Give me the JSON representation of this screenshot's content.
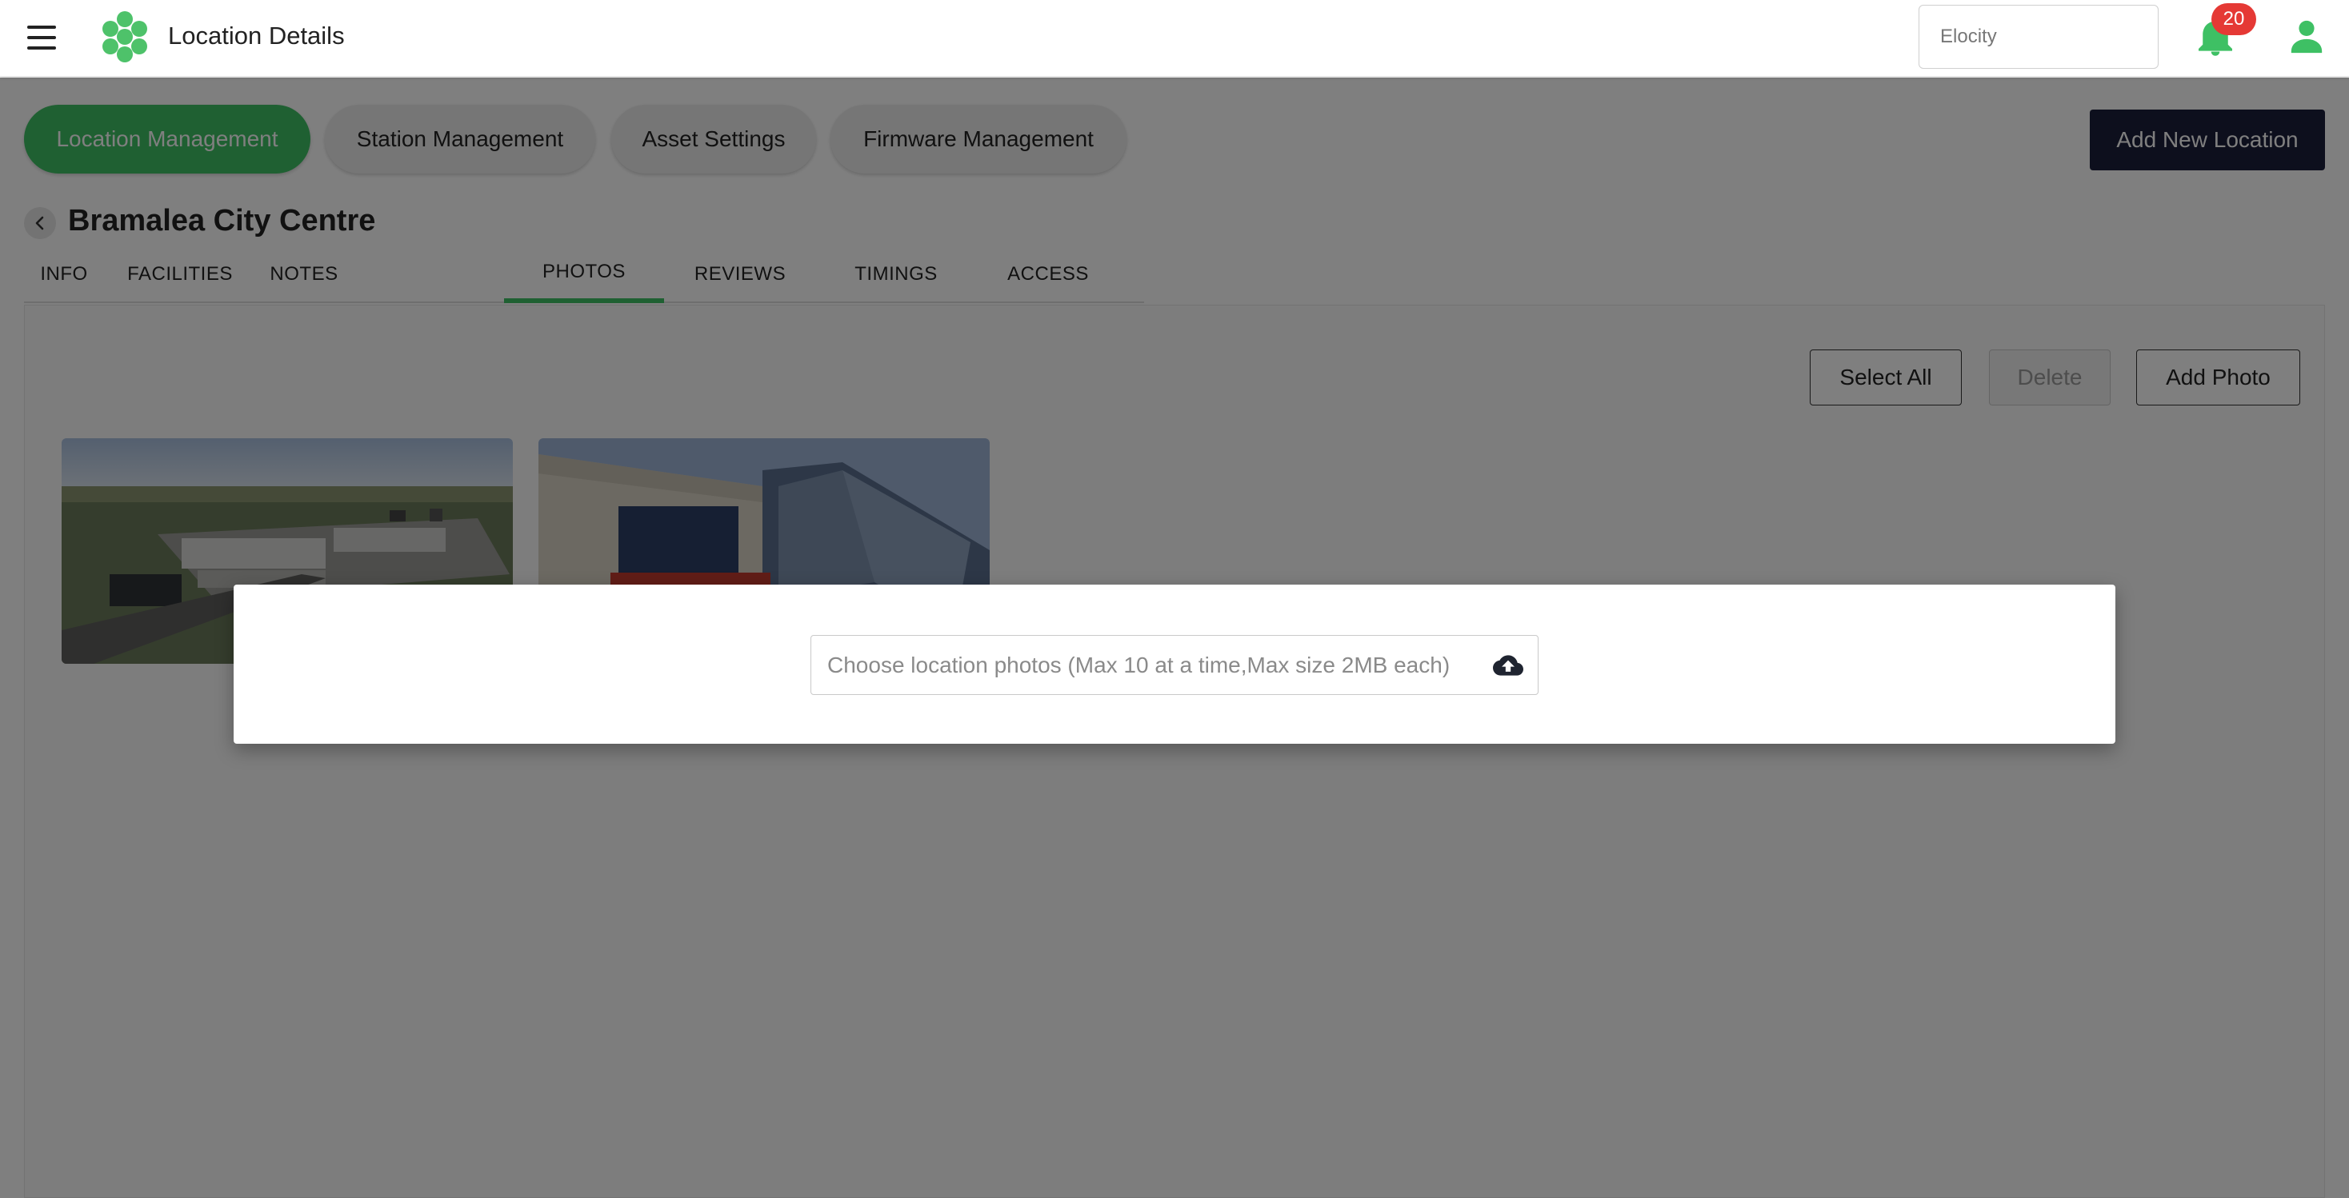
{
  "app": {
    "title": "Location Details",
    "organization_placeholder": "Elocity",
    "notification_count": "20"
  },
  "nav_tabs": [
    {
      "label": "Location Management",
      "active": true
    },
    {
      "label": "Station Management",
      "active": false
    },
    {
      "label": "Asset Settings",
      "active": false
    },
    {
      "label": "Firmware Management",
      "active": false
    }
  ],
  "add_location_label": "Add New Location",
  "location": {
    "name": "Bramalea City Centre"
  },
  "detail_tabs": [
    {
      "label": "INFO",
      "active": false
    },
    {
      "label": "FACILITIES",
      "active": false
    },
    {
      "label": "NOTES",
      "active": false
    },
    {
      "label": "PHOTOS",
      "active": true
    },
    {
      "label": "REVIEWS",
      "active": false
    },
    {
      "label": "TIMINGS",
      "active": false
    },
    {
      "label": "ACCESS",
      "active": false
    }
  ],
  "photo_actions": {
    "select_all": "Select All",
    "delete": "Delete",
    "add_photo": "Add Photo"
  },
  "photos": [
    "aerial-mall-photo",
    "mall-entrance-photo"
  ],
  "dialog": {
    "file_placeholder": "Choose location photos (Max 10 at a time,Max size 2MB each)"
  },
  "colors": {
    "accent": "#3ec064",
    "dark_button": "#1b1e3b",
    "badge": "#e53935"
  },
  "icons": {
    "menu": "hamburger-menu-icon",
    "logo": "hexagon-cluster-logo",
    "notifications": "bell-icon",
    "profile": "user-icon",
    "back": "chevron-left-icon",
    "upload": "cloud-upload-icon"
  }
}
